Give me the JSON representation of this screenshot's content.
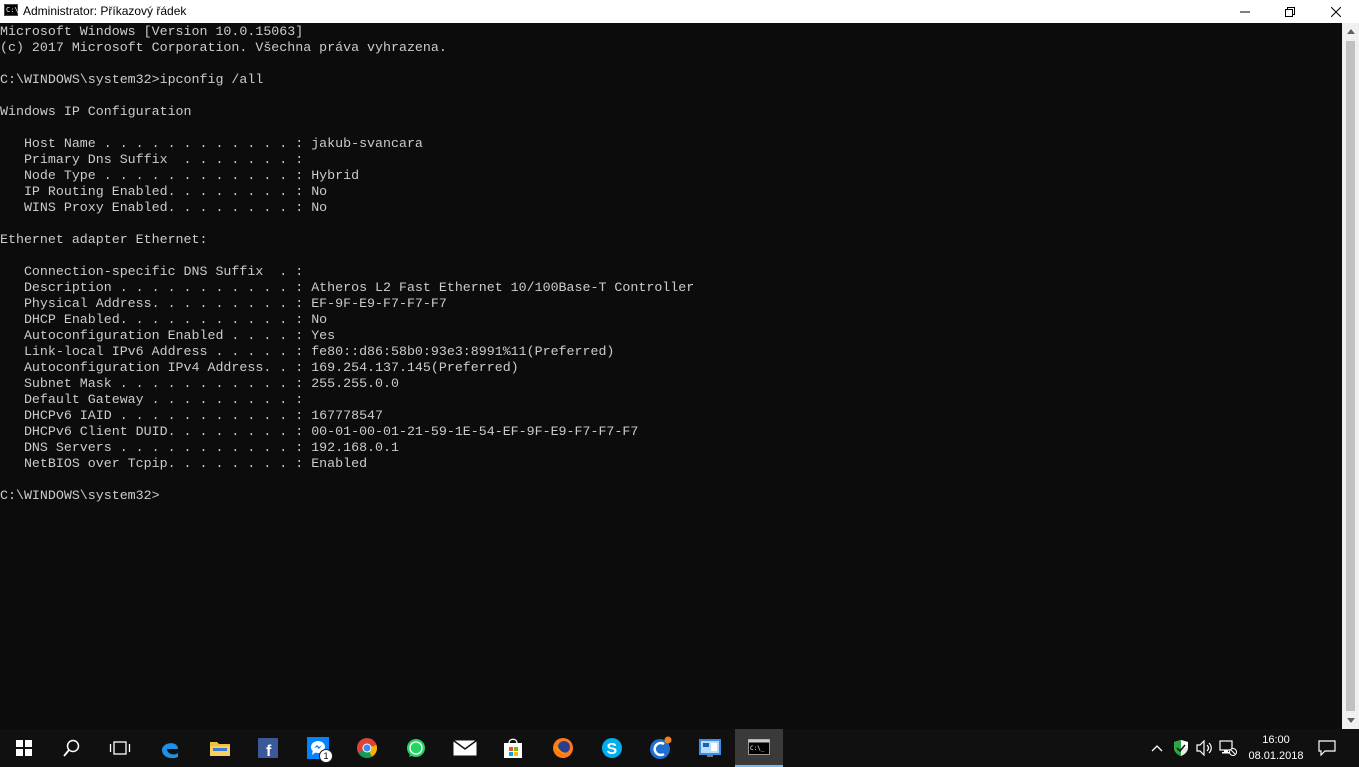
{
  "window": {
    "title": "Administrator: Příkazový řádek",
    "icon_text": "C:\\",
    "controls": {
      "minimize": "—",
      "maximize": "☐",
      "close": "✕"
    }
  },
  "console": {
    "lines": [
      "Microsoft Windows [Version 10.0.15063]",
      "(c) 2017 Microsoft Corporation. Všechna práva vyhrazena.",
      "",
      "C:\\WINDOWS\\system32>ipconfig /all",
      "",
      "Windows IP Configuration",
      "",
      "   Host Name . . . . . . . . . . . . : jakub-svancara",
      "   Primary Dns Suffix  . . . . . . . :",
      "   Node Type . . . . . . . . . . . . : Hybrid",
      "   IP Routing Enabled. . . . . . . . : No",
      "   WINS Proxy Enabled. . . . . . . . : No",
      "",
      "Ethernet adapter Ethernet:",
      "",
      "   Connection-specific DNS Suffix  . :",
      "   Description . . . . . . . . . . . : Atheros L2 Fast Ethernet 10/100Base-T Controller",
      "   Physical Address. . . . . . . . . : EF-9F-E9-F7-F7-F7",
      "   DHCP Enabled. . . . . . . . . . . : No",
      "   Autoconfiguration Enabled . . . . : Yes",
      "   Link-local IPv6 Address . . . . . : fe80::d86:58b0:93e3:8991%11(Preferred)",
      "   Autoconfiguration IPv4 Address. . : 169.254.137.145(Preferred)",
      "   Subnet Mask . . . . . . . . . . . : 255.255.0.0",
      "   Default Gateway . . . . . . . . . :",
      "   DHCPv6 IAID . . . . . . . . . . . : 167778547",
      "   DHCPv6 Client DUID. . . . . . . . : 00-01-00-01-21-59-1E-54-EF-9F-E9-F7-F7-F7",
      "   DNS Servers . . . . . . . . . . . : 192.168.0.1",
      "   NetBIOS over Tcpip. . . . . . . . : Enabled",
      "",
      "C:\\WINDOWS\\system32>"
    ]
  },
  "taskbar": {
    "apps": [
      {
        "name": "start-button",
        "icon": "windows-icon"
      },
      {
        "name": "search-button",
        "icon": "search-icon"
      },
      {
        "name": "task-view-button",
        "icon": "task-view-icon"
      },
      {
        "name": "edge-button",
        "icon": "edge-icon"
      },
      {
        "name": "file-explorer-button",
        "icon": "folder-icon"
      },
      {
        "name": "facebook-button",
        "icon": "facebook-icon"
      },
      {
        "name": "messenger-button",
        "icon": "messenger-icon",
        "badge": "1"
      },
      {
        "name": "chrome-button",
        "icon": "chrome-icon"
      },
      {
        "name": "whatsapp-button",
        "icon": "whatsapp-icon"
      },
      {
        "name": "mail-button",
        "icon": "mail-icon"
      },
      {
        "name": "store-button",
        "icon": "store-icon"
      },
      {
        "name": "firefox-button",
        "icon": "firefox-icon"
      },
      {
        "name": "skype-button",
        "icon": "skype-icon"
      },
      {
        "name": "ccleaner-button",
        "icon": "ccleaner-icon"
      },
      {
        "name": "control-panel-button",
        "icon": "control-panel-icon"
      },
      {
        "name": "cmd-button",
        "icon": "cmd-icon",
        "active": true
      }
    ],
    "tray": {
      "chevron": "^",
      "time": "16:00",
      "date": "08.01.2018"
    }
  },
  "colors": {
    "console_bg": "#0c0c0c",
    "console_text": "#cccccc",
    "taskbar_bg": "#101010",
    "active_accent": "#76b9ed"
  }
}
